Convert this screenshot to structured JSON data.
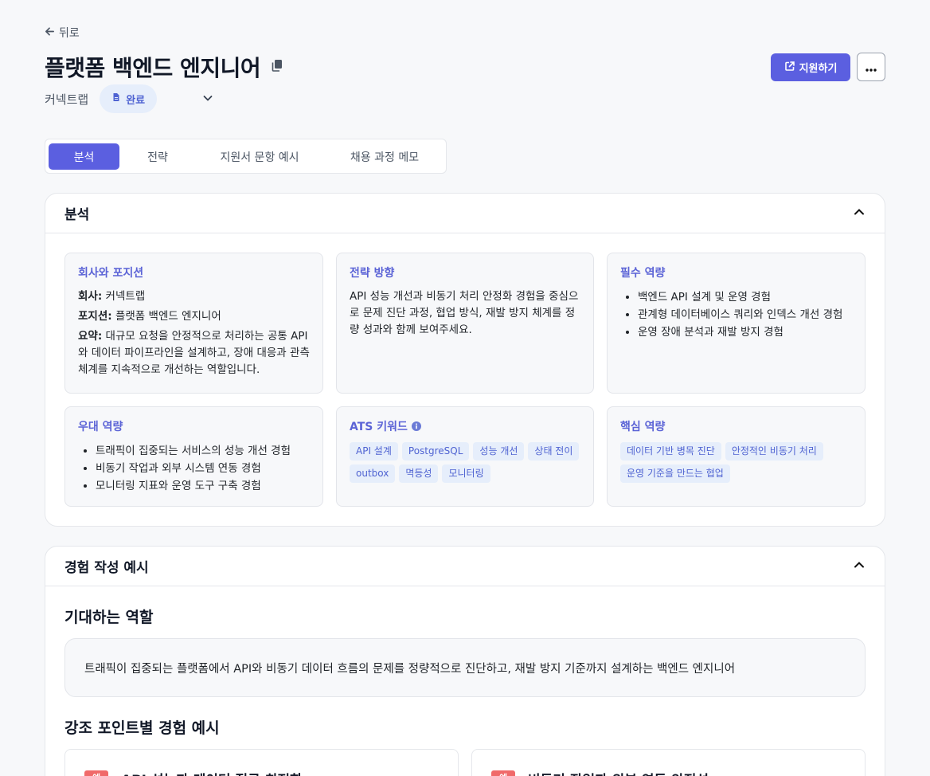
{
  "nav": {
    "back_label": "뒤로"
  },
  "header": {
    "title": "플랫폼 백엔드 엔지니어",
    "company": "커넥트랩",
    "status": "완료",
    "apply_label": "지원하기"
  },
  "tabs": [
    "분석",
    "전략",
    "지원서 문항 예시",
    "채용 과정 메모"
  ],
  "analysis": {
    "title": "분석",
    "company_position": {
      "title": "회사와 포지션",
      "company_key": "회사:",
      "company_val": "커넥트랩",
      "position_key": "포지션:",
      "position_val": "플랫폼 백엔드 엔지니어",
      "summary_key": "요약:",
      "summary_val": "대규모 요청을 안정적으로 처리하는 공통 API와 데이터 파이프라인을 설계하고, 장애 대응과 관측 체계를 지속적으로 개선하는 역할입니다."
    },
    "strategy": {
      "title": "전략 방향",
      "text": "API 성능 개선과 비동기 처리 안정화 경험을 중심으로 문제 진단 과정, 협업 방식, 재발 방지 체계를 정량 성과와 함께 보여주세요."
    },
    "required": {
      "title": "필수 역량",
      "items": [
        "백엔드 API 설계 및 운영 경험",
        "관계형 데이터베이스 쿼리와 인덱스 개선 경험",
        "운영 장애 분석과 재발 방지 경험"
      ]
    },
    "preferred": {
      "title": "우대 역량",
      "items": [
        "트래픽이 집중되는 서비스의 성능 개선 경험",
        "비동기 작업과 외부 시스템 연동 경험",
        "모니터링 지표와 운영 도구 구축 경험"
      ]
    },
    "ats": {
      "title": "ATS 키워드",
      "tags": [
        "API 설계",
        "PostgreSQL",
        "성능 개선",
        "상태 전이",
        "outbox",
        "멱등성",
        "모니터링"
      ]
    },
    "core": {
      "title": "핵심 역량",
      "tags": [
        "데이터 기반 병목 진단",
        "안정적인 비동기 처리",
        "운영 기준을 만드는 협업"
      ]
    }
  },
  "experience": {
    "title": "경험 작성 예시",
    "role_heading": "기대하는 역할",
    "role_text": "트래픽이 집중되는 플랫폼에서 API와 비동기 데이터 흐름의 문제를 정량적으로 진단하고, 재발 방지 기준까지 설계하는 백엔드 엔지니어",
    "points_heading": "강조 포인트별 경험 예시",
    "examples": [
      {
        "badge": "예",
        "title": "API 성능과 데이터 접근 최적화"
      },
      {
        "badge": "예",
        "title": "비동기 작업과 외부 연동 안정성"
      }
    ]
  }
}
